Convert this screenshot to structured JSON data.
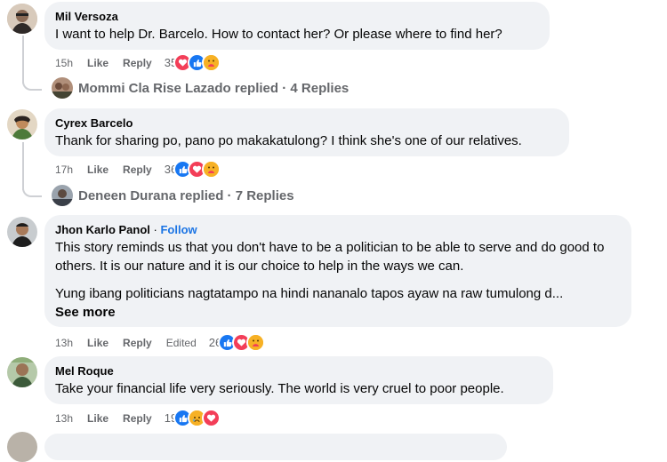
{
  "comments": [
    {
      "author": "Mil Versoza",
      "text": [
        "I want to help Dr. Barcelo. How to contact her? Or please where to find her?"
      ],
      "time": "15h",
      "like_label": "Like",
      "reply_label": "Reply",
      "reaction_count": "35",
      "reactions": [
        "love",
        "like",
        "care"
      ],
      "replies_text": "Mommi Cla Rise Lazado replied · 4 Replies"
    },
    {
      "author": "Cyrex Barcelo",
      "text": [
        "Thank for sharing po, pano po makakatulong? I think she's one of our relatives."
      ],
      "time": "17h",
      "like_label": "Like",
      "reply_label": "Reply",
      "reaction_count": "36",
      "reactions": [
        "like",
        "love",
        "care"
      ],
      "replies_text": "Deneen Durana replied · 7 Replies"
    },
    {
      "author": "Jhon Karlo Panol",
      "follow": "Follow",
      "text": [
        "This story reminds us that you don't have to be a politician to be able to serve and do good to others. It is our nature and it is our choice to help in the ways we can.",
        "Yung ibang politicians nagtatampo na hindi nananalo tapos ayaw na raw tumulong d..."
      ],
      "see_more": "See more",
      "time": "13h",
      "like_label": "Like",
      "reply_label": "Reply",
      "edited_label": "Edited",
      "reaction_count": "26",
      "reactions": [
        "like",
        "love",
        "care"
      ]
    },
    {
      "author": "Mel Roque",
      "text": [
        "Take your financial life very seriously. The world is very cruel to poor people."
      ],
      "time": "13h",
      "like_label": "Like",
      "reply_label": "Reply",
      "reaction_count": "19",
      "reactions": [
        "like",
        "sad",
        "love"
      ]
    }
  ],
  "colors": {
    "bubble": "#f0f2f5",
    "meta": "#65676b",
    "link": "#1b74e4",
    "like": "#1877f2",
    "love": "#f33e58",
    "care": "#f7b125"
  }
}
